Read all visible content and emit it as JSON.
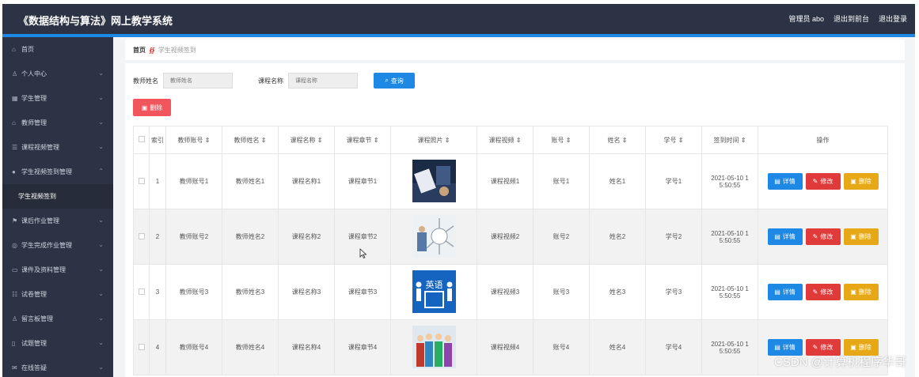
{
  "app": {
    "title": "《数据结构与算法》网上教学系统"
  },
  "topbar": {
    "admin_label": "管理员 abo",
    "back_label": "退出到前台",
    "logout_label": "退出登录"
  },
  "sidebar": {
    "items": [
      {
        "icon": "home-icon",
        "glyph": "⌂",
        "label": "首页",
        "chevron": false
      },
      {
        "icon": "user-icon",
        "glyph": "♙",
        "label": "个人中心",
        "chevron": true
      },
      {
        "icon": "grid-icon",
        "glyph": "▦",
        "label": "学生管理",
        "chevron": true
      },
      {
        "icon": "bank-icon",
        "glyph": "⌂",
        "label": "教师管理",
        "chevron": true
      },
      {
        "icon": "sliders-icon",
        "glyph": "☰",
        "label": "课程视频管理",
        "chevron": true
      },
      {
        "icon": "location-icon",
        "glyph": "●",
        "label": "学生视频签到管理",
        "chevron": "up"
      },
      {
        "sub": true,
        "label": "学生视频签到"
      },
      {
        "icon": "flag-icon",
        "glyph": "⚑",
        "label": "课后作业管理",
        "chevron": true
      },
      {
        "icon": "globe-icon",
        "glyph": "◎",
        "label": "学生完成作业管理",
        "chevron": true
      },
      {
        "icon": "folder-icon",
        "glyph": "▭",
        "label": "课件及资料管理",
        "chevron": true
      },
      {
        "icon": "exam-icon",
        "glyph": "☷",
        "label": "试卷管理",
        "chevron": true
      },
      {
        "icon": "message-icon",
        "glyph": "♙",
        "label": "留言板管理",
        "chevron": true
      },
      {
        "icon": "lamp-icon",
        "glyph": "▯",
        "label": "试题管理",
        "chevron": true
      },
      {
        "icon": "mail-icon",
        "glyph": "✉",
        "label": "在线答疑",
        "chevron": true
      }
    ]
  },
  "breadcrumb": {
    "home": "首页",
    "current": "学生视频签到"
  },
  "search": {
    "teacher_label": "教师姓名",
    "teacher_placeholder": "教师姓名",
    "course_label": "课程名称",
    "course_placeholder": "课程名称",
    "query_button": "查询"
  },
  "actions": {
    "delete_button": "删除"
  },
  "table": {
    "headers": [
      "索引",
      "教师账号",
      "教师姓名",
      "课程名称",
      "课程章节",
      "课程照片",
      "课程视频",
      "账号",
      "姓名",
      "学号",
      "签到时间",
      "操作"
    ],
    "rows": [
      {
        "index": "1",
        "teacher_account": "教师账号1",
        "teacher_name": "教师姓名1",
        "course_name": "课程名称1",
        "chapter": "课程章节1",
        "video": "课程视频1",
        "account": "账号1",
        "name": "姓名1",
        "student_no": "学号1",
        "time1": "2021-05-10 1",
        "time2": "5:50:55"
      },
      {
        "index": "2",
        "teacher_account": "教师账号2",
        "teacher_name": "教师姓名2",
        "course_name": "课程名称2",
        "chapter": "课程章节2",
        "video": "课程视频2",
        "account": "账号2",
        "name": "姓名2",
        "student_no": "学号2",
        "time1": "2021-05-10 1",
        "time2": "5:50:55"
      },
      {
        "index": "3",
        "teacher_account": "教师账号3",
        "teacher_name": "教师姓名3",
        "course_name": "课程名称3",
        "chapter": "课程章节3",
        "video": "课程视频3",
        "account": "账号3",
        "name": "姓名3",
        "student_no": "学号3",
        "time1": "2021-05-10 1",
        "time2": "5:50:55"
      },
      {
        "index": "4",
        "teacher_account": "教师账号4",
        "teacher_name": "教师姓名4",
        "course_name": "课程名称4",
        "chapter": "课程章节4",
        "video": "课程视频4",
        "account": "账号4",
        "name": "姓名4",
        "student_no": "学号4",
        "time1": "2021-05-10 1",
        "time2": "5:50:55"
      }
    ],
    "row_buttons": {
      "detail": "详情",
      "edit": "修改",
      "delete": "删除"
    },
    "thumb_texts": {
      "row3": "英语"
    }
  },
  "watermark": "CSDN @计算机程序华哥",
  "colors": {
    "topbar": "#2c3344",
    "accent": "#1e88e5",
    "danger": "#e03a3a",
    "warning": "#e6a817",
    "delete_top": "#f0565c"
  }
}
